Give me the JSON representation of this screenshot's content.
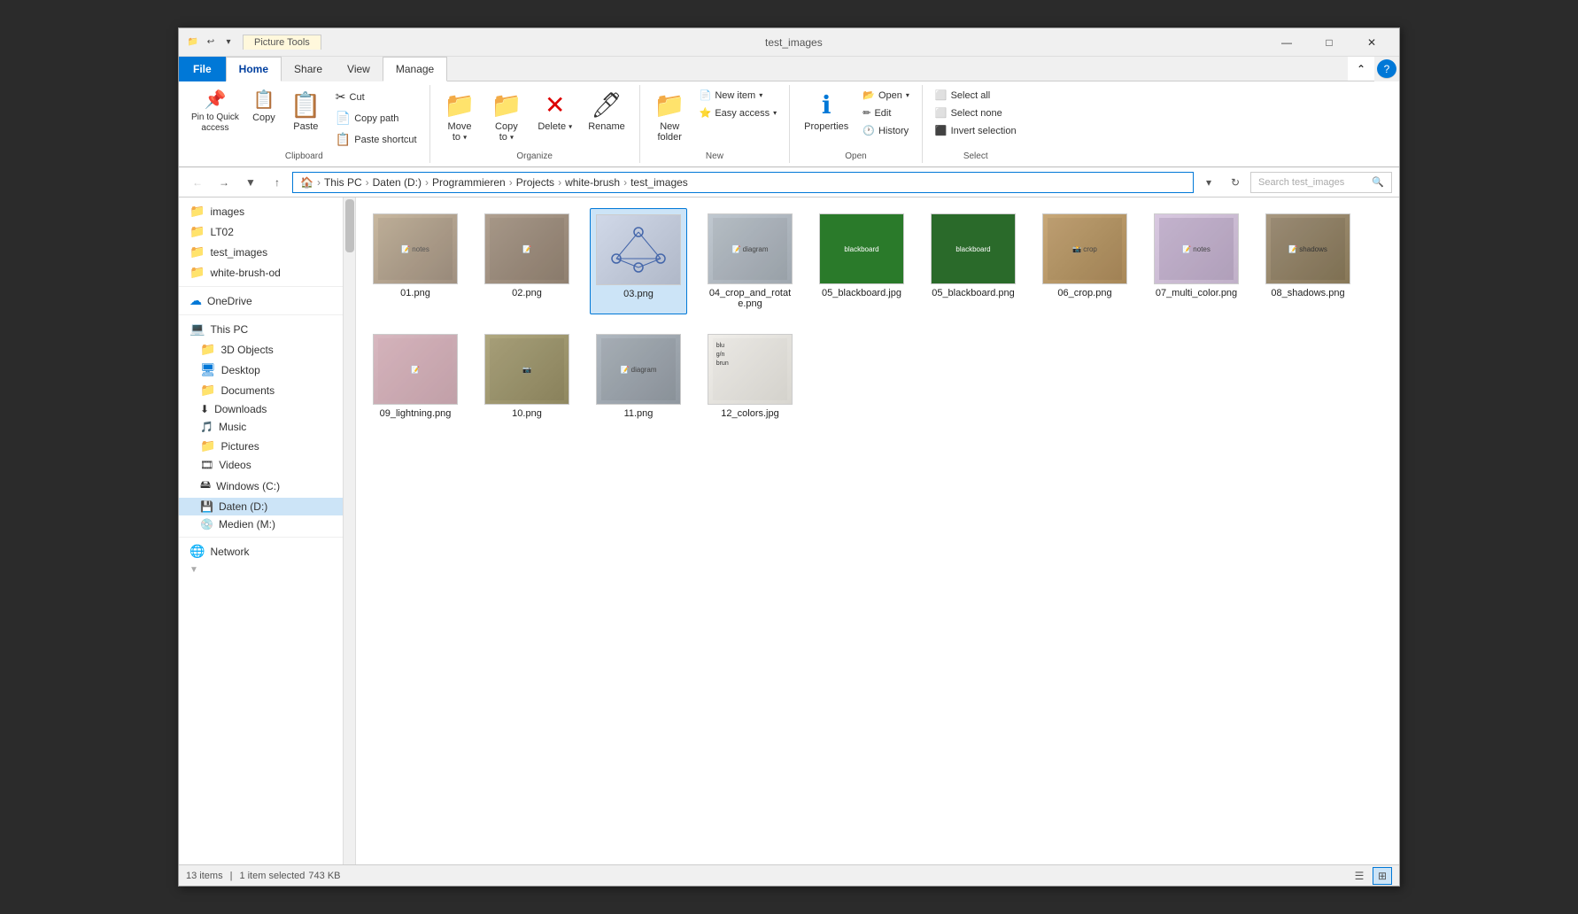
{
  "window": {
    "title": "test_images",
    "picture_tools_label": "Picture Tools",
    "controls": {
      "minimize": "—",
      "maximize": "□",
      "close": "✕"
    }
  },
  "ribbon_tabs": [
    {
      "id": "file",
      "label": "File"
    },
    {
      "id": "home",
      "label": "Home",
      "active": true
    },
    {
      "id": "share",
      "label": "Share"
    },
    {
      "id": "view",
      "label": "View"
    },
    {
      "id": "manage",
      "label": "Manage"
    }
  ],
  "ribbon": {
    "clipboard": {
      "label": "Clipboard",
      "pin_to_quick_access": "Pin to Quick\naccess",
      "copy": "Copy",
      "paste": "Paste",
      "cut": "Cut",
      "copy_path": "Copy path",
      "paste_shortcut": "Paste shortcut"
    },
    "organize": {
      "label": "Organize",
      "move_to": "Move\nto",
      "copy_to": "Copy\nto",
      "delete": "Delete",
      "rename": "Rename"
    },
    "new": {
      "label": "New",
      "new_folder": "New\nfolder",
      "new_item": "New item",
      "easy_access": "Easy access"
    },
    "open": {
      "label": "Open",
      "open": "Open",
      "edit": "Edit",
      "history": "History",
      "properties": "Properties"
    },
    "select": {
      "label": "Select",
      "select_all": "Select all",
      "select_none": "Select none",
      "invert_selection": "Invert selection"
    }
  },
  "address_bar": {
    "path_parts": [
      "This PC",
      "Daten (D:)",
      "Programmieren",
      "Projects",
      "white-brush",
      "test_images"
    ],
    "search_placeholder": "Search test_images"
  },
  "sidebar": {
    "quick_access": [
      {
        "label": "images",
        "type": "folder-yellow"
      },
      {
        "label": "LT02",
        "type": "folder-yellow"
      },
      {
        "label": "test_images",
        "type": "folder-yellow"
      },
      {
        "label": "white-brush-od",
        "type": "folder-yellow"
      }
    ],
    "onedrive": {
      "label": "OneDrive"
    },
    "this_pc": {
      "label": "This PC",
      "items": [
        {
          "label": "3D Objects",
          "type": "folder-special"
        },
        {
          "label": "Desktop",
          "type": "folder-blue"
        },
        {
          "label": "Documents",
          "type": "folder-yellow"
        },
        {
          "label": "Downloads",
          "type": "folder-download"
        },
        {
          "label": "Music",
          "type": "music"
        },
        {
          "label": "Pictures",
          "type": "folder-yellow"
        },
        {
          "label": "Videos",
          "type": "folder-video"
        },
        {
          "label": "Windows (C:)",
          "type": "drive-windows"
        },
        {
          "label": "Daten (D:)",
          "type": "drive",
          "selected": true
        },
        {
          "label": "Medien (M:)",
          "type": "drive-cd"
        }
      ]
    },
    "network": {
      "label": "Network"
    }
  },
  "files": [
    {
      "name": "01.png",
      "thumb": "thumb-01",
      "selected": false
    },
    {
      "name": "02.png",
      "thumb": "thumb-02",
      "selected": false
    },
    {
      "name": "03.png",
      "thumb": "thumb-03",
      "selected": true
    },
    {
      "name": "04_crop_and_rotate.png",
      "thumb": "thumb-04",
      "selected": false
    },
    {
      "name": "05_blackboard.jpg",
      "thumb": "thumb-05a",
      "selected": false
    },
    {
      "name": "05_blackboard.png",
      "thumb": "thumb-05b",
      "selected": false
    },
    {
      "name": "06_crop.png",
      "thumb": "thumb-06",
      "selected": false
    },
    {
      "name": "07_multi_color.png",
      "thumb": "thumb-07",
      "selected": false
    },
    {
      "name": "08_shadows.png",
      "thumb": "thumb-08",
      "selected": false
    },
    {
      "name": "09_lightning.png",
      "thumb": "thumb-09",
      "selected": false
    },
    {
      "name": "10.png",
      "thumb": "thumb-10",
      "selected": false
    },
    {
      "name": "11.png",
      "thumb": "thumb-11",
      "selected": false
    },
    {
      "name": "12_colors.jpg",
      "thumb": "thumb-12",
      "selected": false
    }
  ],
  "status_bar": {
    "item_count": "13 items",
    "selected": "1 item selected",
    "size": "743 KB"
  }
}
